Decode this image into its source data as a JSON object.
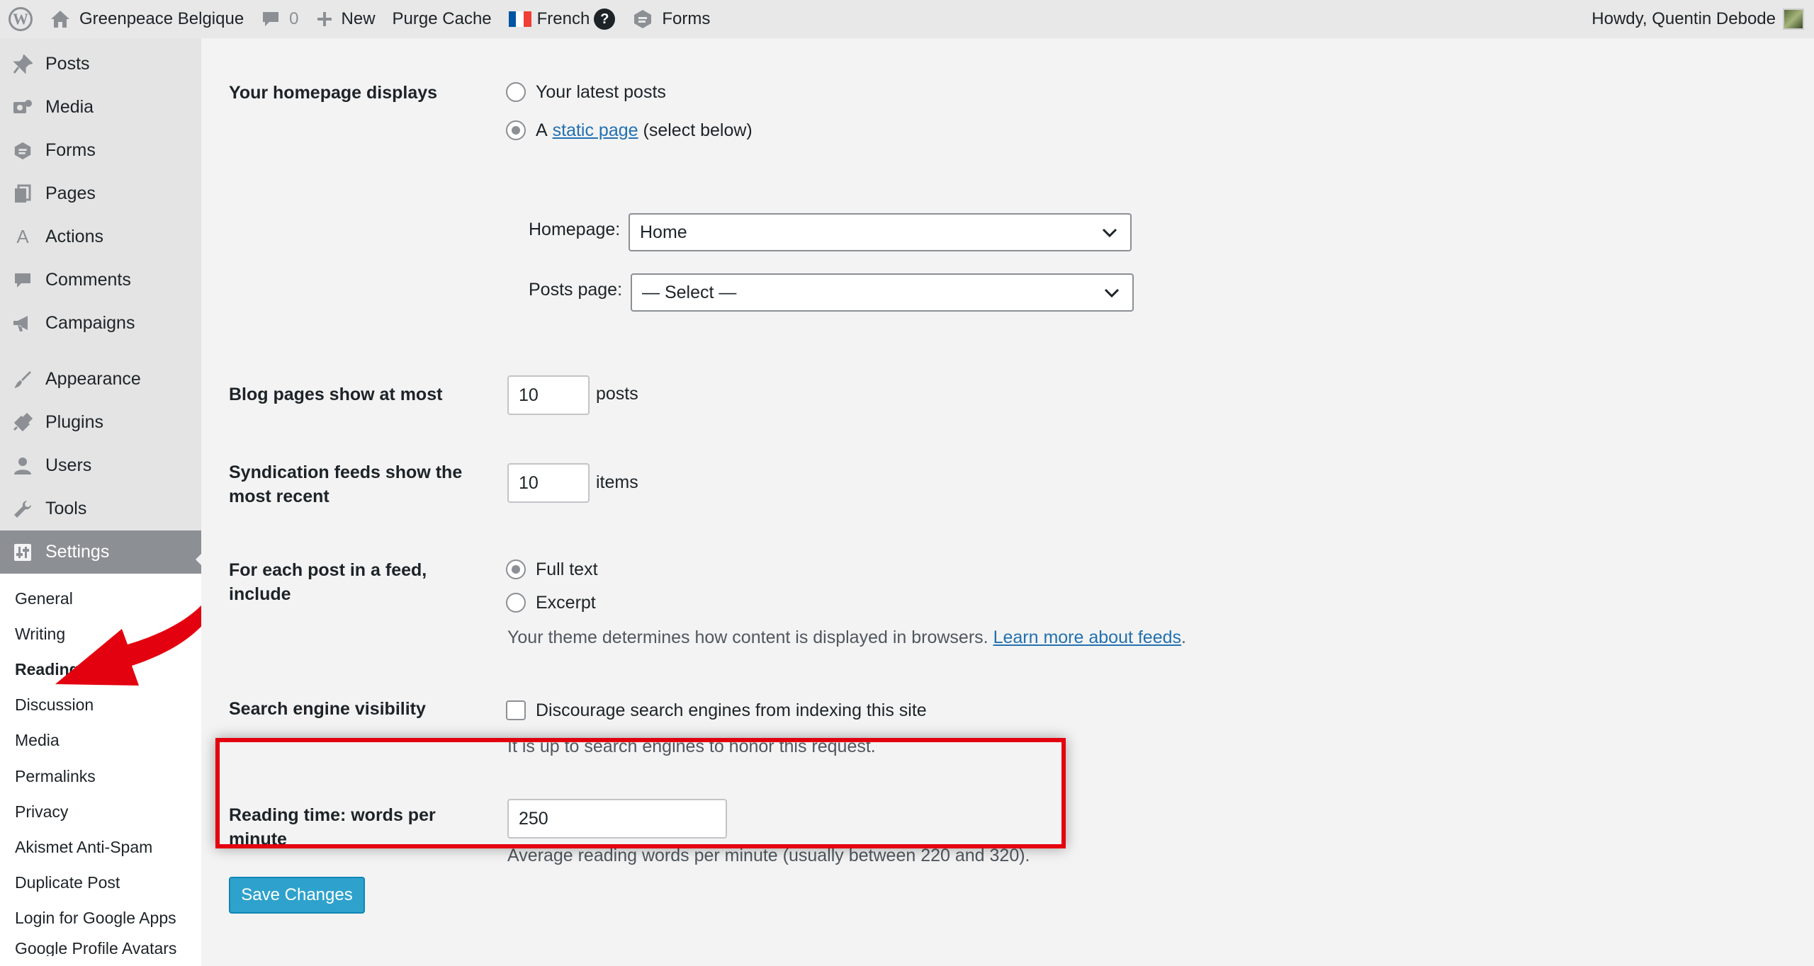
{
  "adminbar": {
    "site_name": "Greenpeace Belgique",
    "comments_count": "0",
    "new_label": "New",
    "purge_label": "Purge Cache",
    "language_label": "French",
    "help_glyph": "?",
    "forms_label": "Forms",
    "howdy": "Howdy, Quentin Debode"
  },
  "sidebar": {
    "items": [
      {
        "label": "Posts",
        "icon": "pin-icon"
      },
      {
        "label": "Media",
        "icon": "media-icon"
      },
      {
        "label": "Forms",
        "icon": "forms-icon"
      },
      {
        "label": "Pages",
        "icon": "pages-icon"
      },
      {
        "label": "Actions",
        "icon": "actions-icon"
      },
      {
        "label": "Comments",
        "icon": "comment-icon"
      },
      {
        "label": "Campaigns",
        "icon": "megaphone-icon"
      },
      {
        "label": "Appearance",
        "icon": "brush-icon"
      },
      {
        "label": "Plugins",
        "icon": "plug-icon"
      },
      {
        "label": "Users",
        "icon": "user-icon"
      },
      {
        "label": "Tools",
        "icon": "wrench-icon"
      },
      {
        "label": "Settings",
        "icon": "settings-icon"
      }
    ],
    "submenu": [
      "General",
      "Writing",
      "Reading",
      "Discussion",
      "Media",
      "Permalinks",
      "Privacy",
      "Akismet Anti-Spam",
      "Duplicate Post",
      "Login for Google Apps",
      "Google Profile Avatars"
    ]
  },
  "settings": {
    "homepage_displays": {
      "label": "Your homepage displays",
      "option_latest": "Your latest posts",
      "option_static_prefix": "A",
      "option_static_link": "static page",
      "option_static_suffix": "(select below)",
      "homepage_label": "Homepage:",
      "homepage_value": "Home",
      "posts_page_label": "Posts page:",
      "posts_page_value": "— Select —"
    },
    "blog_pages": {
      "label": "Blog pages show at most",
      "value": "10",
      "unit": "posts"
    },
    "syndication": {
      "label": "Syndication feeds show the most recent",
      "value": "10",
      "unit": "items"
    },
    "feed_include": {
      "label": "For each post in a feed, include",
      "option_full": "Full text",
      "option_excerpt": "Excerpt",
      "desc_prefix": "Your theme determines how content is displayed in browsers.",
      "desc_link": "Learn more about feeds",
      "desc_suffix": "."
    },
    "search_visibility": {
      "label": "Search engine visibility",
      "checkbox_label": "Discourage search engines from indexing this site",
      "desc": "It is up to search engines to honor this request."
    },
    "reading_time": {
      "label": "Reading time: words per minute",
      "value": "250",
      "desc": "Average reading words per minute (usually between 220 and 320)."
    },
    "save_label": "Save Changes"
  },
  "colors": {
    "highlight": "#e3000f",
    "primary_button": "#2ea2cc",
    "link": "#2271b1"
  }
}
